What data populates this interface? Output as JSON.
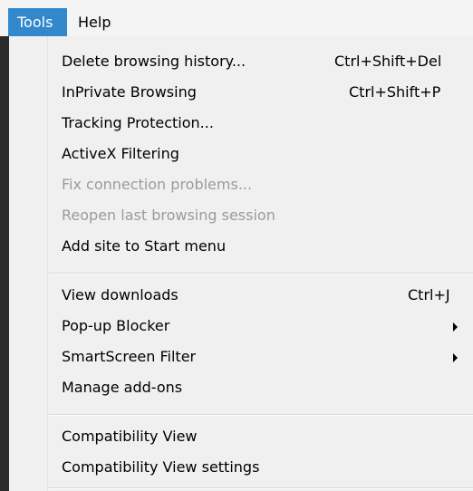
{
  "menubar": {
    "tools": "Tools",
    "help": "Help"
  },
  "menu": {
    "delete_history": {
      "label": "Delete browsing history...",
      "shortcut": "Ctrl+Shift+Del"
    },
    "inprivate": {
      "label": "InPrivate Browsing",
      "shortcut": "Ctrl+Shift+P"
    },
    "tracking": {
      "label": "Tracking Protection..."
    },
    "activex": {
      "label": "ActiveX Filtering"
    },
    "fix_connection": {
      "label": "Fix connection problems..."
    },
    "reopen_session": {
      "label": "Reopen last browsing session"
    },
    "add_site": {
      "label": "Add site to Start menu"
    },
    "view_downloads": {
      "label": "View downloads",
      "shortcut": "Ctrl+J"
    },
    "popup_blocker": {
      "label": "Pop-up Blocker"
    },
    "smartscreen": {
      "label": "SmartScreen Filter"
    },
    "manage_addons": {
      "label": "Manage add-ons"
    },
    "compat_view": {
      "label": "Compatibility View"
    },
    "compat_settings": {
      "label": "Compatibility View settings"
    }
  },
  "colors": {
    "highlight": "#3388cc",
    "menu_bg": "#f0f0f0",
    "disabled_text": "#9b9b9b"
  },
  "icons": {
    "submenu": "chevron-right-icon"
  }
}
